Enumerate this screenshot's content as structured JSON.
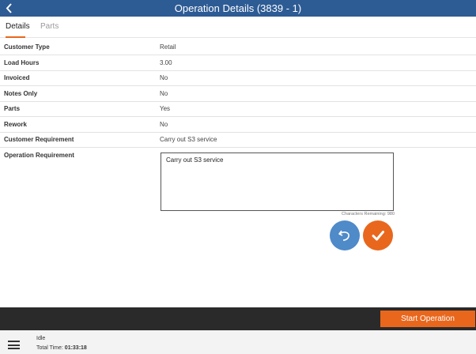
{
  "header": {
    "title": "Operation Details (3839 - 1)",
    "back_icon": "chevron-left-icon"
  },
  "tabs": [
    {
      "label": "Details",
      "active": true
    },
    {
      "label": "Parts",
      "active": false
    }
  ],
  "details": [
    {
      "label": "Customer Type",
      "value": "Retail"
    },
    {
      "label": "Load Hours",
      "value": "3.00"
    },
    {
      "label": "Invoiced",
      "value": "No"
    },
    {
      "label": "Notes Only",
      "value": "No"
    },
    {
      "label": "Parts",
      "value": "Yes"
    },
    {
      "label": "Rework",
      "value": "No"
    },
    {
      "label": "Customer Requirement",
      "value": "Carry out S3 service"
    }
  ],
  "operation_requirement": {
    "label": "Operation Requirement",
    "value": "Carry out S3 service",
    "chars_remaining": "Characters Remaining: 980"
  },
  "actions": {
    "undo_icon": "undo-icon",
    "confirm_icon": "checkmark-icon",
    "start_label": "Start Operation"
  },
  "status": {
    "state": "Idle",
    "total_label": "Total Time:",
    "total_value": "01:33:18",
    "menu_icon": "hamburger-menu-icon"
  },
  "colors": {
    "header": "#2d5b94",
    "accent": "#e8671d",
    "undo": "#4f8ac9",
    "footer": "#2a2a2a"
  }
}
